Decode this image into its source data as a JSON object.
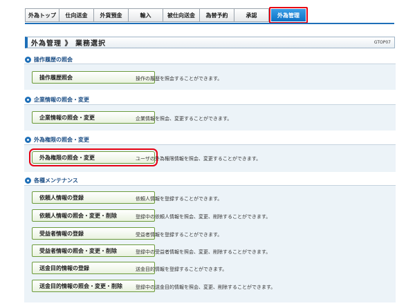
{
  "tabs": [
    {
      "label": "外為トップ",
      "active": false
    },
    {
      "label": "仕向送金",
      "active": false
    },
    {
      "label": "外貨預金",
      "active": false
    },
    {
      "label": "輸入",
      "active": false
    },
    {
      "label": "被仕向送金",
      "active": false
    },
    {
      "label": "為替予約",
      "active": false
    },
    {
      "label": "承認",
      "active": false
    },
    {
      "label": "外為管理",
      "active": true
    }
  ],
  "header": {
    "title": "外為管理 》 業務選択",
    "screen_id": "GTOP07"
  },
  "sections": [
    {
      "title": "操作履歴の照会",
      "items": [
        {
          "label": "操作履歴照会",
          "description": "操作の履歴を照会することができます。"
        }
      ]
    },
    {
      "title": "企業情報の照会・変更",
      "items": [
        {
          "label": "企業情報の照会・変更",
          "description": "企業情報を照会、変更することができます。"
        }
      ]
    },
    {
      "title": "外為権限の照会・変更",
      "items": [
        {
          "label": "外為権限の照会・変更",
          "description": "ユーザの外為権限情報を照会、変更することができます。"
        }
      ]
    },
    {
      "title": "各種メンテナンス",
      "items": [
        {
          "label": "依頼人情報の登録",
          "description": "依頼人情報を登録することができます。"
        },
        {
          "label": "依頼人情報の照会・変更・削除",
          "description": "登録中の依頼人情報を照会、変更、削除することができます。"
        },
        {
          "label": "受益者情報の登録",
          "description": "受益者情報を登録することができます。"
        },
        {
          "label": "受益者情報の照会・変更・削除",
          "description": "登録中の受益者情報を照会、変更、削除することができます。"
        },
        {
          "label": "送金目的情報の登録",
          "description": "送金目的情報を登録することができます。"
        },
        {
          "label": "送金目的情報の照会・変更・削除",
          "description": "登録中の送金目的情報を照会、変更、削除することができます。"
        }
      ]
    }
  ],
  "colors": {
    "accent": "#1d6fb8",
    "highlight": "#e60012",
    "button_border": "#6a9a3a"
  }
}
